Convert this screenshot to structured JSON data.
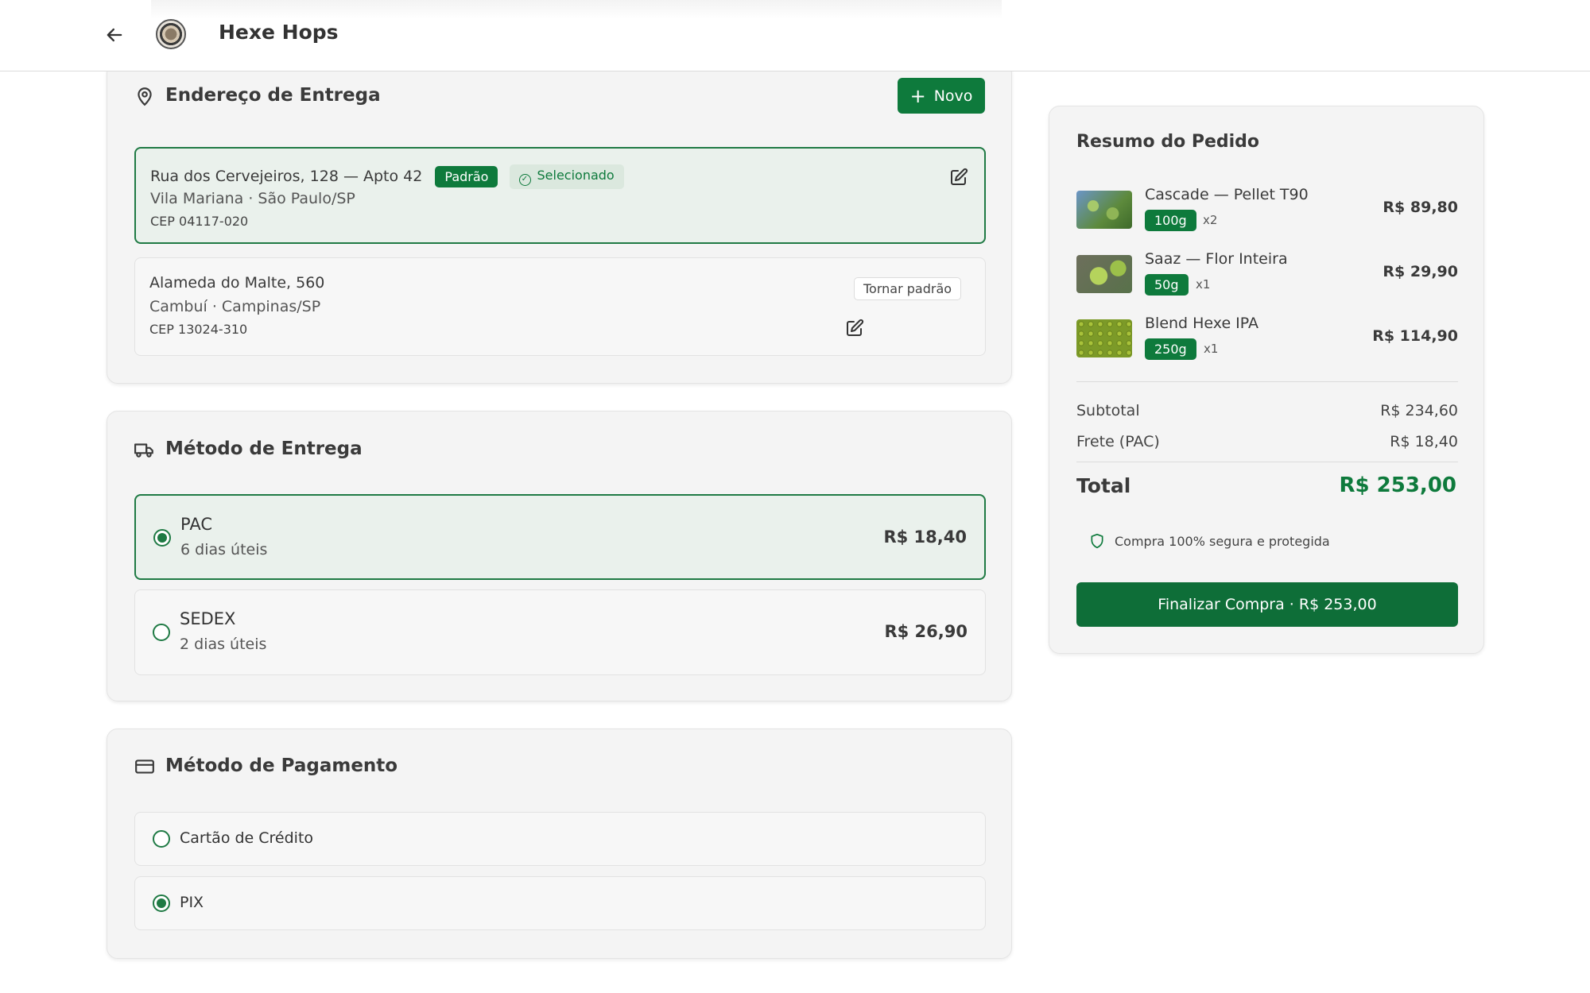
{
  "header": {
    "brand": "Hexe Hops"
  },
  "address": {
    "title": "Endereço de Entrega",
    "new_label": "Novo",
    "items": [
      {
        "street": "Rua dos Cervejeiros, 128 — Apto 42",
        "badge_default": "Padrão",
        "badge_selected": "Selecionado",
        "city": "Vila Mariana · São Paulo/SP",
        "cep": "CEP 04117-020"
      },
      {
        "street": "Alameda do Malte, 560",
        "city": "Cambuí · Campinas/SP",
        "cep": "CEP 13024-310",
        "make_default": "Tornar padrão"
      }
    ]
  },
  "delivery": {
    "title": "Método de Entrega",
    "options": [
      {
        "name": "PAC",
        "days": "6 dias úteis",
        "price": "R$ 18,40",
        "selected": true
      },
      {
        "name": "SEDEX",
        "days": "2 dias úteis",
        "price": "R$ 26,90",
        "selected": false
      }
    ]
  },
  "payment": {
    "title": "Método de Pagamento",
    "options": [
      {
        "name": "Cartão de Crédito",
        "selected": false
      },
      {
        "name": "PIX",
        "selected": true
      }
    ]
  },
  "summary": {
    "title": "Resumo do Pedido",
    "items": [
      {
        "name": "Cascade — Pellet T90",
        "weight": "100g",
        "qty": "x2",
        "price": "R$ 89,80"
      },
      {
        "name": "Saaz — Flor Inteira",
        "weight": "50g",
        "qty": "x1",
        "price": "R$ 29,90"
      },
      {
        "name": "Blend Hexe IPA",
        "weight": "250g",
        "qty": "x1",
        "price": "R$ 114,90"
      }
    ],
    "subtotal_label": "Subtotal",
    "subtotal_value": "R$ 234,60",
    "shipping_label": "Frete (PAC)",
    "shipping_value": "R$ 18,40",
    "total_label": "Total",
    "total_value": "R$ 253,00",
    "secure_text": "Compra 100% segura e protegida",
    "checkout_label": "Finalizar Compra · R$ 253,00"
  },
  "colors": {
    "accent": "#0e7a3c",
    "selected_bg": "#eaf1ec",
    "card_bg": "#f4f4f4"
  }
}
